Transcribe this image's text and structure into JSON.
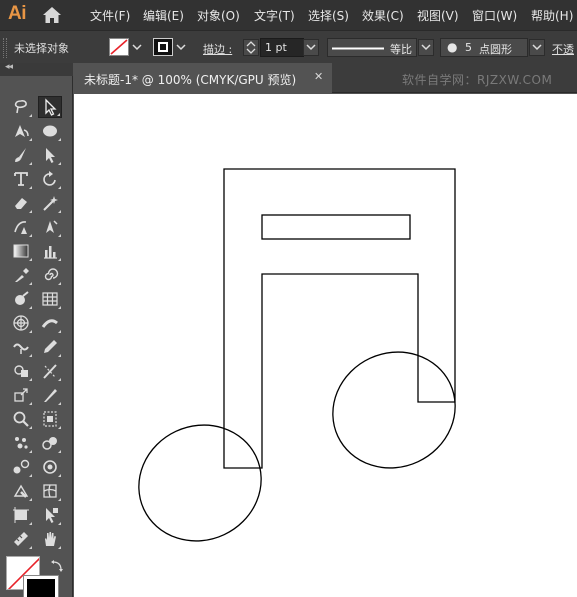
{
  "app": {
    "logo": "Ai"
  },
  "menu": [
    "文件(F)",
    "编辑(E)",
    "对象(O)",
    "文字(T)",
    "选择(S)",
    "效果(C)",
    "视图(V)",
    "窗口(W)",
    "帮助(H)"
  ],
  "control_bar": {
    "selection_status": "未选择对象",
    "stroke_label": "描边 :",
    "stroke_weight": "1 pt",
    "profile_label": "等比",
    "brush_size": "5",
    "brush_label": "点圆形",
    "opacity_label": "不透"
  },
  "document_tab": {
    "title": "未标题-1* @ 100% (CMYK/GPU 预览)",
    "close_glyph": "✕"
  },
  "watermark": "软件自学网：RJZXW.COM",
  "toolbar": {
    "collapse_glyph": "◂◂",
    "tools": [
      "lasso-icon",
      "selection-tool-icon",
      "pen-icon",
      "ellipse-icon",
      "paintbrush-icon",
      "direct-selection-icon",
      "type-icon",
      "rotate-icon",
      "eraser-icon",
      "magic-wand-icon",
      "curvature-icon",
      "anchor-pen-icon",
      "gradient-icon",
      "column-graph-icon",
      "eyedropper-icon",
      "spiral-icon",
      "blob-brush-icon",
      "grid-icon",
      "polar-grid-icon",
      "width-icon",
      "warp-icon",
      "pencil-icon",
      "shape-builder-icon",
      "knife-icon",
      "scale-icon",
      "slice-icon",
      "zoom-icon",
      "print-tiling-icon",
      "symbol-sprayer-icon",
      "symbolism-icon",
      "blend-icon",
      "symbol-shifter-icon",
      "live-paint-icon",
      "mesh-icon",
      "artboard-icon",
      "live-paint-selection-icon",
      "measure-icon",
      "hand-icon"
    ]
  },
  "colors": {
    "accent_logo": "#e99645",
    "canvas": "#ffffff",
    "chrome": "#535353"
  }
}
